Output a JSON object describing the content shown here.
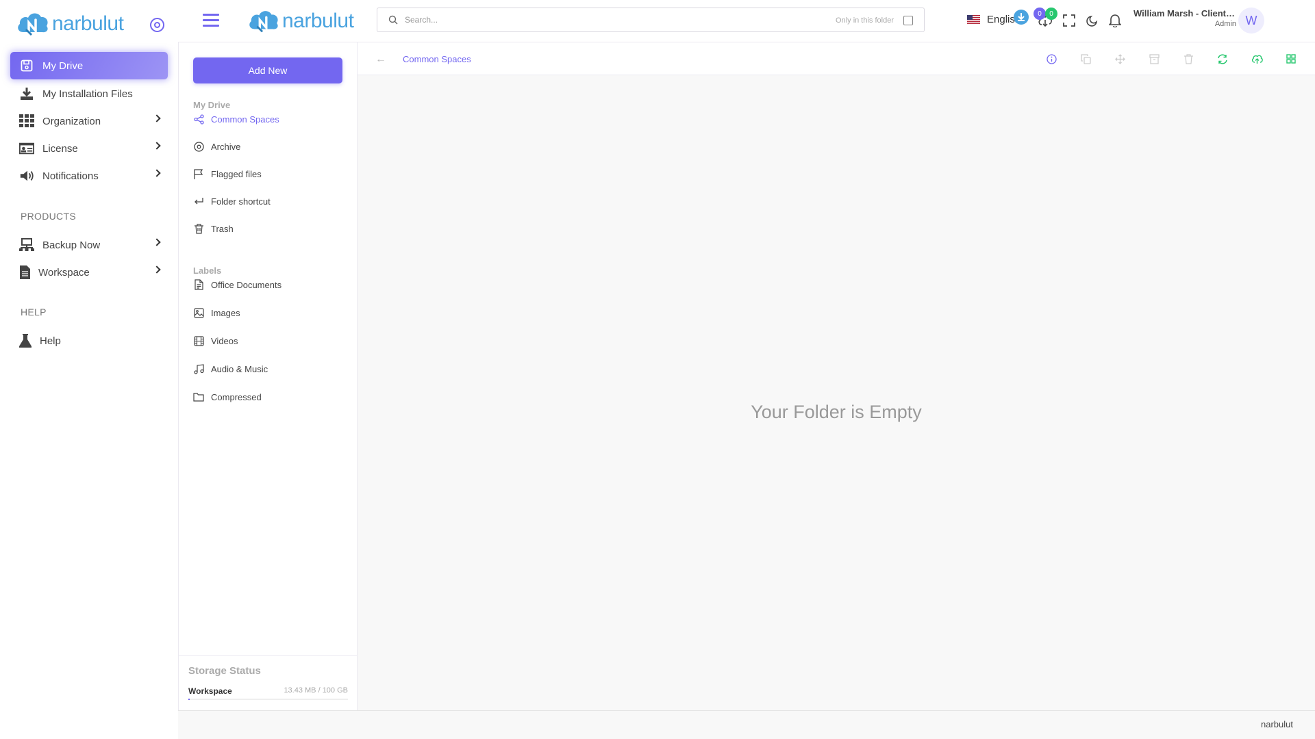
{
  "brand": {
    "name": "narbulut"
  },
  "sidebar": {
    "items": [
      {
        "label": "My Drive",
        "icon": "drive-icon",
        "active": true
      },
      {
        "label": "My Installation Files",
        "icon": "download-icon"
      },
      {
        "label": "Organization",
        "icon": "grid-icon"
      },
      {
        "label": "License",
        "icon": "id-card-icon"
      },
      {
        "label": "Notifications",
        "icon": "megaphone-icon"
      }
    ],
    "products_heading": "PRODUCTS",
    "products": [
      {
        "label": "Backup Now",
        "icon": "network-icon"
      },
      {
        "label": "Workspace",
        "icon": "document-icon"
      }
    ],
    "help_heading": "HELP",
    "help": [
      {
        "label": "Help",
        "icon": "flask-icon"
      }
    ]
  },
  "header": {
    "search_placeholder": "Search...",
    "only_in_folder": "Only in this folder",
    "language": "English",
    "badge_left": "0",
    "badge_right": "0",
    "user_name": "William Marsh - Client Ad...",
    "user_role": "Admin",
    "avatar_initial": "W"
  },
  "panel": {
    "add_new": "Add New",
    "my_drive_heading": "My Drive",
    "my_drive_items": [
      {
        "label": "Common Spaces",
        "icon": "share-icon",
        "active": true
      },
      {
        "label": "Archive",
        "icon": "archive-disc-icon"
      },
      {
        "label": "Flagged files",
        "icon": "flag-icon"
      },
      {
        "label": "Folder shortcut",
        "icon": "corner-arrow-icon"
      },
      {
        "label": "Trash",
        "icon": "trash-icon"
      }
    ],
    "labels_heading": "Labels",
    "label_items": [
      {
        "label": "Office Documents",
        "icon": "file-text-icon"
      },
      {
        "label": "Images",
        "icon": "image-icon"
      },
      {
        "label": "Videos",
        "icon": "film-icon"
      },
      {
        "label": "Audio & Music",
        "icon": "music-icon"
      },
      {
        "label": "Compressed",
        "icon": "folder-icon"
      }
    ],
    "storage": {
      "title": "Storage Status",
      "label": "Workspace",
      "value": "13.43 MB / 100 GB",
      "used_fraction": 0.0001
    }
  },
  "main": {
    "breadcrumb": "Common Spaces",
    "empty_message": "Your Folder is Empty"
  },
  "footer": {
    "text": "narbulut"
  },
  "colors": {
    "accent": "#7367f0",
    "brand": "#4aa3df",
    "success": "#28c76f"
  }
}
